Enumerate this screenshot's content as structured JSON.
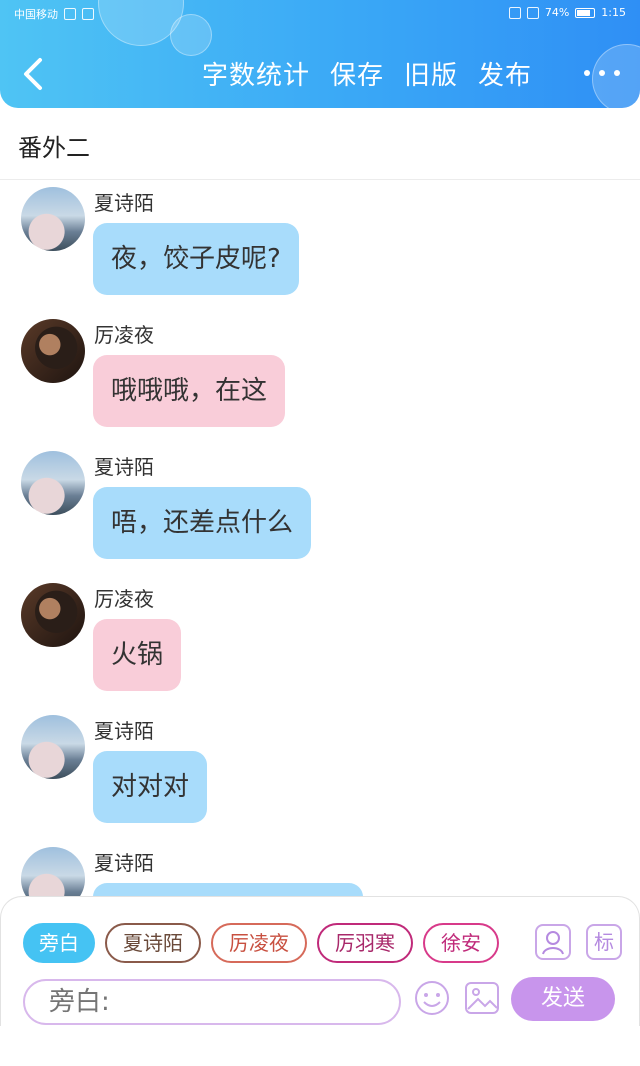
{
  "status_bar": {
    "carrier": "中国移动",
    "battery": "74%",
    "time": "1:15"
  },
  "header": {
    "back_icon": "chevron-left-icon",
    "actions": [
      "字数统计",
      "保存",
      "旧版",
      "发布"
    ],
    "more_icon": "more-dots-icon",
    "gradient_start": "#4fc4f4",
    "gradient_end": "#2f8ff5"
  },
  "chapter": {
    "title": "番外二"
  },
  "messages": [
    {
      "speaker": "夏诗陌",
      "text": "夜，饺子皮呢?",
      "color": "#a8dcfb"
    },
    {
      "speaker": "厉凌夜",
      "text": "哦哦哦，在这",
      "color": "#f9cdd9"
    },
    {
      "speaker": "夏诗陌",
      "text": "唔，还差点什么",
      "color": "#a8dcfb"
    },
    {
      "speaker": "厉凌夜",
      "text": "火锅",
      "color": "#f9cdd9"
    },
    {
      "speaker": "夏诗陌",
      "text": "对对对",
      "color": "#a8dcfb"
    },
    {
      "speaker": "夏诗陌",
      "text": "",
      "color": "#a8dcfb"
    }
  ],
  "composer": {
    "roles": [
      "旁白",
      "夏诗陌",
      "厉凌夜",
      "厉羽寒",
      "徐安"
    ],
    "active_role": "旁白",
    "input_placeholder": "旁白:",
    "send_label": "发送",
    "tool_icons": [
      "character-icon",
      "tag-icon",
      "emoji-icon",
      "image-icon"
    ],
    "tag_glyph": "标",
    "accent": "#c895ec"
  }
}
